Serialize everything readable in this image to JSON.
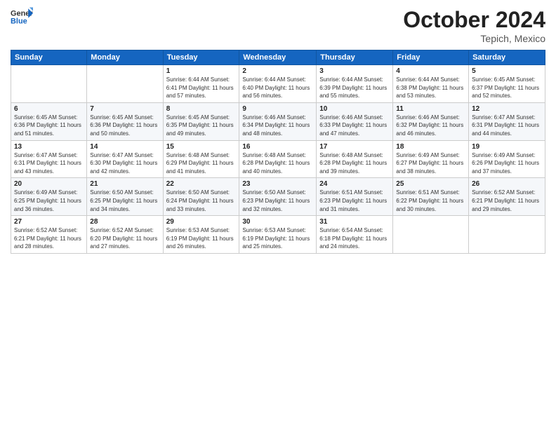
{
  "logo": {
    "line1": "General",
    "line2": "Blue"
  },
  "header": {
    "month": "October 2024",
    "location": "Tepich, Mexico"
  },
  "weekdays": [
    "Sunday",
    "Monday",
    "Tuesday",
    "Wednesday",
    "Thursday",
    "Friday",
    "Saturday"
  ],
  "weeks": [
    [
      {
        "day": "",
        "info": ""
      },
      {
        "day": "",
        "info": ""
      },
      {
        "day": "1",
        "info": "Sunrise: 6:44 AM\nSunset: 6:41 PM\nDaylight: 11 hours and 57 minutes."
      },
      {
        "day": "2",
        "info": "Sunrise: 6:44 AM\nSunset: 6:40 PM\nDaylight: 11 hours and 56 minutes."
      },
      {
        "day": "3",
        "info": "Sunrise: 6:44 AM\nSunset: 6:39 PM\nDaylight: 11 hours and 55 minutes."
      },
      {
        "day": "4",
        "info": "Sunrise: 6:44 AM\nSunset: 6:38 PM\nDaylight: 11 hours and 53 minutes."
      },
      {
        "day": "5",
        "info": "Sunrise: 6:45 AM\nSunset: 6:37 PM\nDaylight: 11 hours and 52 minutes."
      }
    ],
    [
      {
        "day": "6",
        "info": "Sunrise: 6:45 AM\nSunset: 6:36 PM\nDaylight: 11 hours and 51 minutes."
      },
      {
        "day": "7",
        "info": "Sunrise: 6:45 AM\nSunset: 6:36 PM\nDaylight: 11 hours and 50 minutes."
      },
      {
        "day": "8",
        "info": "Sunrise: 6:45 AM\nSunset: 6:35 PM\nDaylight: 11 hours and 49 minutes."
      },
      {
        "day": "9",
        "info": "Sunrise: 6:46 AM\nSunset: 6:34 PM\nDaylight: 11 hours and 48 minutes."
      },
      {
        "day": "10",
        "info": "Sunrise: 6:46 AM\nSunset: 6:33 PM\nDaylight: 11 hours and 47 minutes."
      },
      {
        "day": "11",
        "info": "Sunrise: 6:46 AM\nSunset: 6:32 PM\nDaylight: 11 hours and 46 minutes."
      },
      {
        "day": "12",
        "info": "Sunrise: 6:47 AM\nSunset: 6:31 PM\nDaylight: 11 hours and 44 minutes."
      }
    ],
    [
      {
        "day": "13",
        "info": "Sunrise: 6:47 AM\nSunset: 6:31 PM\nDaylight: 11 hours and 43 minutes."
      },
      {
        "day": "14",
        "info": "Sunrise: 6:47 AM\nSunset: 6:30 PM\nDaylight: 11 hours and 42 minutes."
      },
      {
        "day": "15",
        "info": "Sunrise: 6:48 AM\nSunset: 6:29 PM\nDaylight: 11 hours and 41 minutes."
      },
      {
        "day": "16",
        "info": "Sunrise: 6:48 AM\nSunset: 6:28 PM\nDaylight: 11 hours and 40 minutes."
      },
      {
        "day": "17",
        "info": "Sunrise: 6:48 AM\nSunset: 6:28 PM\nDaylight: 11 hours and 39 minutes."
      },
      {
        "day": "18",
        "info": "Sunrise: 6:49 AM\nSunset: 6:27 PM\nDaylight: 11 hours and 38 minutes."
      },
      {
        "day": "19",
        "info": "Sunrise: 6:49 AM\nSunset: 6:26 PM\nDaylight: 11 hours and 37 minutes."
      }
    ],
    [
      {
        "day": "20",
        "info": "Sunrise: 6:49 AM\nSunset: 6:25 PM\nDaylight: 11 hours and 36 minutes."
      },
      {
        "day": "21",
        "info": "Sunrise: 6:50 AM\nSunset: 6:25 PM\nDaylight: 11 hours and 34 minutes."
      },
      {
        "day": "22",
        "info": "Sunrise: 6:50 AM\nSunset: 6:24 PM\nDaylight: 11 hours and 33 minutes."
      },
      {
        "day": "23",
        "info": "Sunrise: 6:50 AM\nSunset: 6:23 PM\nDaylight: 11 hours and 32 minutes."
      },
      {
        "day": "24",
        "info": "Sunrise: 6:51 AM\nSunset: 6:23 PM\nDaylight: 11 hours and 31 minutes."
      },
      {
        "day": "25",
        "info": "Sunrise: 6:51 AM\nSunset: 6:22 PM\nDaylight: 11 hours and 30 minutes."
      },
      {
        "day": "26",
        "info": "Sunrise: 6:52 AM\nSunset: 6:21 PM\nDaylight: 11 hours and 29 minutes."
      }
    ],
    [
      {
        "day": "27",
        "info": "Sunrise: 6:52 AM\nSunset: 6:21 PM\nDaylight: 11 hours and 28 minutes."
      },
      {
        "day": "28",
        "info": "Sunrise: 6:52 AM\nSunset: 6:20 PM\nDaylight: 11 hours and 27 minutes."
      },
      {
        "day": "29",
        "info": "Sunrise: 6:53 AM\nSunset: 6:19 PM\nDaylight: 11 hours and 26 minutes."
      },
      {
        "day": "30",
        "info": "Sunrise: 6:53 AM\nSunset: 6:19 PM\nDaylight: 11 hours and 25 minutes."
      },
      {
        "day": "31",
        "info": "Sunrise: 6:54 AM\nSunset: 6:18 PM\nDaylight: 11 hours and 24 minutes."
      },
      {
        "day": "",
        "info": ""
      },
      {
        "day": "",
        "info": ""
      }
    ]
  ]
}
